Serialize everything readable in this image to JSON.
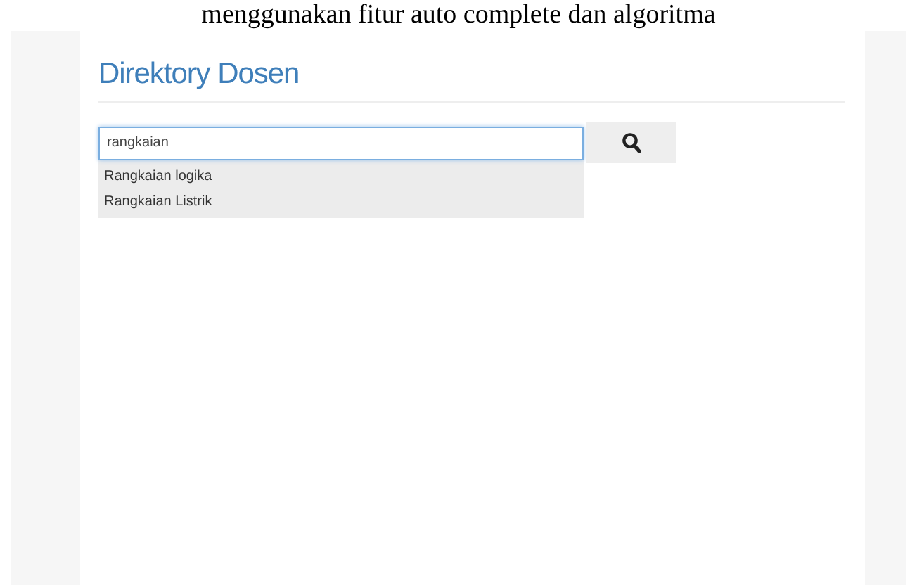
{
  "caption": "menggunakan fitur auto complete dan algoritma",
  "page": {
    "title": "Direktory Dosen"
  },
  "search": {
    "value": "rangkaian"
  },
  "suggestions": [
    {
      "label": "Rangkaian logika"
    },
    {
      "label": "Rangkaian Listrik"
    }
  ]
}
